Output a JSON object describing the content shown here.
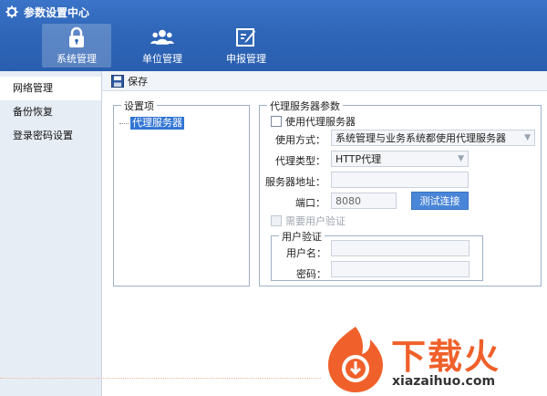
{
  "app": {
    "title": "参数设置中心"
  },
  "nav": {
    "tabs": [
      {
        "label": "系统管理",
        "icon": "lock-icon",
        "active": true
      },
      {
        "label": "单位管理",
        "icon": "users-icon",
        "active": false
      },
      {
        "label": "申报管理",
        "icon": "edit-icon",
        "active": false
      }
    ]
  },
  "sidebar": {
    "items": [
      {
        "label": "网络管理",
        "active": true
      },
      {
        "label": "备份恢复",
        "active": false
      },
      {
        "label": "登录密码设置",
        "active": false
      }
    ]
  },
  "toolbar": {
    "save_label": "保存"
  },
  "settings_group": {
    "title": "设置项",
    "tree_item": "代理服务器"
  },
  "proxy_group": {
    "title": "代理服务器参数",
    "use_proxy_label": "使用代理服务器",
    "use_proxy_checked": false,
    "usage_label": "使用方式：",
    "usage_value": "系统管理与业务系统都使用代理服务器",
    "type_label": "代理类型：",
    "type_value": "HTTP代理",
    "address_label": "服务器地址：",
    "address_value": "",
    "port_label": "端口：",
    "port_value": "8080",
    "test_button": "测试连接",
    "need_auth_label": "需要用户验证",
    "auth_group": {
      "title": "用户验证",
      "username_label": "用户名：",
      "username_value": "",
      "password_label": "密码：",
      "password_value": ""
    }
  },
  "watermark": {
    "brand": "下载火",
    "domain": "xiazaihuo.com"
  },
  "colors": {
    "header": "#2f66b8",
    "accent": "#4a86d8",
    "selection": "#3275d4",
    "watermark": "#f0602a"
  }
}
